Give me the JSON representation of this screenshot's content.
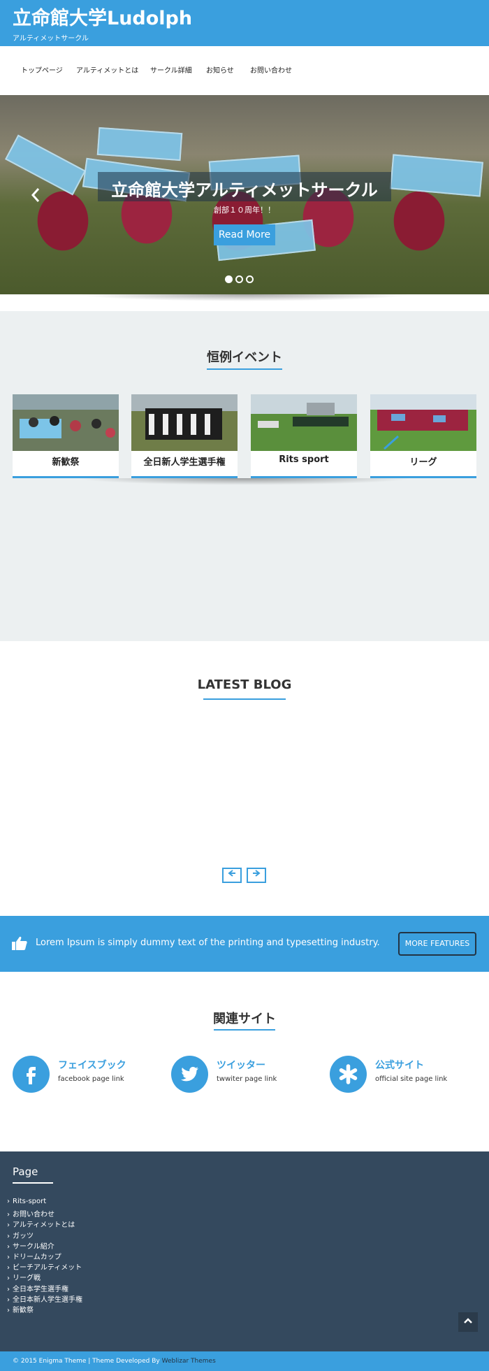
{
  "site": {
    "title": "立命館大学Ludolph",
    "tagline": "アルティメットサークル"
  },
  "nav": {
    "items": [
      "トップページ",
      "アルティメットとは",
      "サークル詳細",
      "お知らせ",
      "お問い合わせ"
    ]
  },
  "hero": {
    "title": "立命館大学アルティメットサークル",
    "subtitle": "創部１０周年！！",
    "button_label": "Read More",
    "prev_icon": "chevron-left-icon",
    "slides": 3,
    "active_slide": 1
  },
  "events": {
    "title": "恒例イベント",
    "cards": [
      {
        "label": "新歓祭"
      },
      {
        "label": "全日新人学生選手権"
      },
      {
        "label": "Rits sport"
      },
      {
        "label": "リーグ"
      }
    ]
  },
  "blog": {
    "title": "LATEST BLOG",
    "prev_icon": "arrow-left-icon",
    "next_icon": "arrow-right-icon"
  },
  "cta": {
    "icon": "thumbs-up-icon",
    "text": "Lorem Ipsum is simply dummy text of the printing and typesetting industry.",
    "button_label": "MORE FEATURES"
  },
  "related": {
    "title": "関連サイト",
    "items": [
      {
        "icon": "facebook-icon",
        "name": "フェイスブック",
        "desc": "facebook page link"
      },
      {
        "icon": "twitter-icon",
        "name": "ツイッター",
        "desc": "twwiter page link"
      },
      {
        "icon": "asterisk-icon",
        "name": "公式サイト",
        "desc": "official site page link"
      }
    ]
  },
  "footer": {
    "title": "Page",
    "links": [
      "Rits-sport",
      "お問い合わせ",
      "アルティメットとは",
      "ガッツ",
      "サークル紹介",
      "ドリームカップ",
      "ビーチアルティメット",
      "リーグ戦",
      "全日本学生選手権",
      "全日本新人学生選手権",
      "新歓祭"
    ],
    "to_top_icon": "chevron-up-icon",
    "copyright_text": "© 2015 Enigma Theme | Theme Developed By",
    "copyright_link": "Weblizar Themes"
  },
  "colors": {
    "accent": "#3a9fde",
    "footer_bg": "#34495e",
    "section_bg": "#ecf0f1"
  }
}
